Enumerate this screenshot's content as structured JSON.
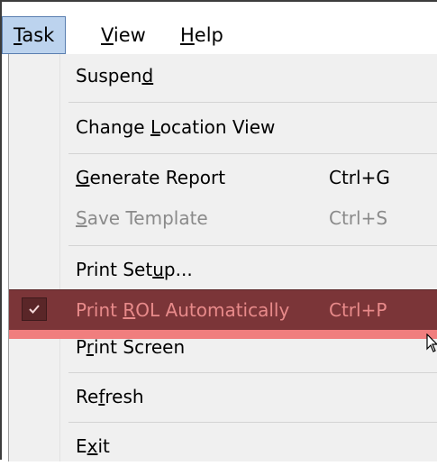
{
  "menubar": {
    "items": [
      {
        "label": "Task",
        "mnemonic": "T",
        "rest": "ask",
        "active": true
      },
      {
        "label": "View",
        "mnemonic": "V",
        "rest": "iew"
      },
      {
        "label": "Help",
        "mnemonic": "H",
        "rest": "elp"
      }
    ]
  },
  "menu": {
    "suspend": {
      "pre": "Suspen",
      "mn": "d",
      "post": ""
    },
    "change_location_view": {
      "pre": "Change ",
      "mn": "L",
      "post": "ocation View"
    },
    "generate_report": {
      "pre": "",
      "mn": "G",
      "post": "enerate Report",
      "shortcut": "Ctrl+G"
    },
    "save_template": {
      "pre": "",
      "mn": "S",
      "post": "ave Template",
      "shortcut": "Ctrl+S",
      "disabled": true
    },
    "print_setup": {
      "pre": "Print Set",
      "mn": "u",
      "post": "p..."
    },
    "print_rol_automatically": {
      "pre": "Print ",
      "mn": "R",
      "post": "OL Automatically",
      "shortcut": "Ctrl+P",
      "checked": true
    },
    "print_screen": {
      "pre": "P",
      "mn": "r",
      "post": "int Screen"
    },
    "refresh": {
      "pre": "Re",
      "mn": "f",
      "post": "resh"
    },
    "exit": {
      "pre": "E",
      "mn": "x",
      "post": "it"
    }
  },
  "colors": {
    "menubar_active_bg": "#bcd3ee",
    "menu_bg": "#f0f0f0",
    "highlight_bg": "#7b3538",
    "highlight_text": "#e88a8a",
    "disabled_text": "#8a8a8a"
  },
  "icons": {
    "check": "check-icon",
    "cursor": "mouse-pointer-icon"
  }
}
